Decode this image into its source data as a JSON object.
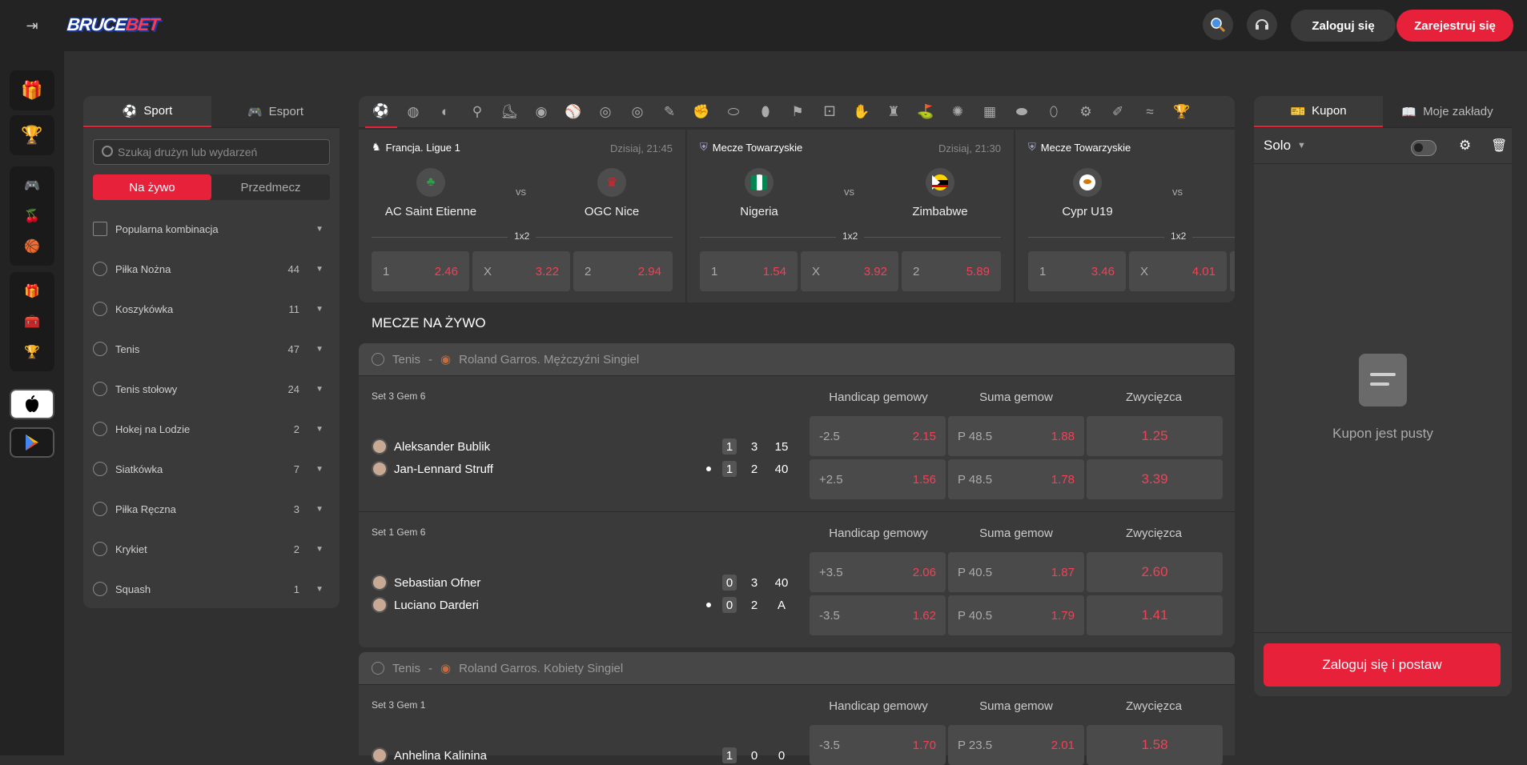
{
  "header": {
    "logo_left": "BRUCE",
    "logo_right": "BET",
    "login_label": "Zaloguj się",
    "register_label": "Zarejestruj się"
  },
  "left_panel": {
    "tab_sport": "Sport",
    "tab_esport": "Esport",
    "search_placeholder": "Szukaj drużyn lub wydarzeń",
    "seg_live": "Na żywo",
    "seg_pre": "Przedmecz",
    "sports": [
      {
        "label": "Popularna kombinacja",
        "count": ""
      },
      {
        "label": "Piłka Nożna",
        "count": "44"
      },
      {
        "label": "Koszykówka",
        "count": "11"
      },
      {
        "label": "Tenis",
        "count": "47"
      },
      {
        "label": "Tenis stołowy",
        "count": "24"
      },
      {
        "label": "Hokej na Lodzie",
        "count": "2"
      },
      {
        "label": "Siatkówka",
        "count": "7"
      },
      {
        "label": "Piłka Ręczna",
        "count": "3"
      },
      {
        "label": "Krykiet",
        "count": "2"
      },
      {
        "label": "Squash",
        "count": "1"
      }
    ]
  },
  "featured": [
    {
      "league": "Francja. Ligue 1",
      "time": "Dzisiaj, 21:45",
      "home": "AC Saint Etienne",
      "away": "OGC Nice",
      "vs": "vs",
      "market": "1x2",
      "odds": [
        {
          "k": "1",
          "v": "2.46"
        },
        {
          "k": "X",
          "v": "3.22"
        },
        {
          "k": "2",
          "v": "2.94"
        }
      ]
    },
    {
      "league": "Mecze Towarzyskie",
      "time": "Dzisiaj, 21:30",
      "home": "Nigeria",
      "away": "Zimbabwe",
      "vs": "vs",
      "market": "1x2",
      "odds": [
        {
          "k": "1",
          "v": "1.54"
        },
        {
          "k": "X",
          "v": "3.92"
        },
        {
          "k": "2",
          "v": "5.89"
        }
      ]
    },
    {
      "league": "Mecze Towarzyskie",
      "time": "",
      "home": "Cypr U19",
      "away": "",
      "vs": "vs",
      "market": "1x2",
      "odds": [
        {
          "k": "1",
          "v": "3.46"
        },
        {
          "k": "X",
          "v": "4.01"
        }
      ]
    }
  ],
  "live_title": "MECZE NA ŻYWO",
  "groups": [
    {
      "sport": "Tenis",
      "sep": "-",
      "tournament": "Roland Garros. Mężczyźni Singiel"
    },
    {
      "sport": "Tenis",
      "sep": "-",
      "tournament": "Roland Garros. Kobiety Singiel"
    }
  ],
  "market_headers": {
    "handicap": "Handicap gemowy",
    "total": "Suma gemow",
    "winner": "Zwycięzca"
  },
  "events": [
    {
      "set": "Set 3 Gem 6",
      "p1": {
        "name": "Aleksander Bublik",
        "sets": "1",
        "games": "3",
        "points": "15"
      },
      "p2": {
        "name": "Jan-Lennard Struff",
        "sets": "1",
        "games": "2",
        "points": "40"
      },
      "h1": {
        "k": "-2.5",
        "v": "2.15"
      },
      "h2": {
        "k": "+2.5",
        "v": "1.56"
      },
      "t1": {
        "k": "P 48.5",
        "v": "1.88"
      },
      "t2": {
        "k": "P 48.5",
        "v": "1.78"
      },
      "w1": "1.25",
      "w2": "3.39"
    },
    {
      "set": "Set 1 Gem 6",
      "p1": {
        "name": "Sebastian Ofner",
        "sets": "0",
        "games": "3",
        "points": "40"
      },
      "p2": {
        "name": "Luciano Darderi",
        "sets": "0",
        "games": "2",
        "points": "A"
      },
      "h1": {
        "k": "+3.5",
        "v": "2.06"
      },
      "h2": {
        "k": "-3.5",
        "v": "1.62"
      },
      "t1": {
        "k": "P 40.5",
        "v": "1.87"
      },
      "t2": {
        "k": "P 40.5",
        "v": "1.79"
      },
      "w1": "2.60",
      "w2": "1.41"
    },
    {
      "set": "Set 3 Gem 1",
      "p1": {
        "name": "Anhelina Kalinina",
        "sets": "1",
        "games": "0",
        "points": "0"
      },
      "h1": {
        "k": "-3.5",
        "v": "1.70"
      },
      "t1": {
        "k": "P 23.5",
        "v": "2.01"
      },
      "w1": "1.58"
    }
  ],
  "coupon": {
    "tab_coupon": "Kupon",
    "tab_bets": "Moje zakłady",
    "mode": "Solo",
    "empty": "Kupon jest pusty",
    "place": "Zaloguj się i postaw"
  },
  "colors": {
    "accent": "#e8213b",
    "odds": "#f24155"
  }
}
